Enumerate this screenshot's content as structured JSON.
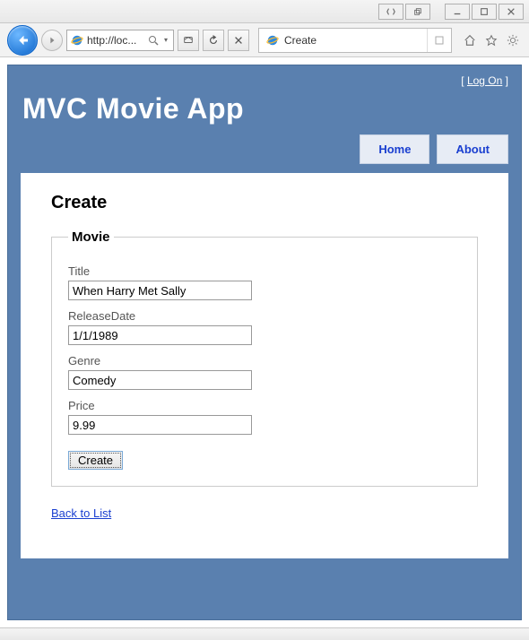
{
  "browser": {
    "url_display": "http://loc...",
    "tab_title": "Create"
  },
  "header": {
    "app_title": "MVC Movie App",
    "logon_left_bracket": "[ ",
    "logon_label": "Log On",
    "logon_right_bracket": " ]"
  },
  "nav": {
    "home": "Home",
    "about": "About"
  },
  "page": {
    "heading": "Create",
    "legend": "Movie",
    "fields": {
      "title_label": "Title",
      "title_value": "When Harry Met Sally",
      "releasedate_label": "ReleaseDate",
      "releasedate_value": "1/1/1989",
      "genre_label": "Genre",
      "genre_value": "Comedy",
      "price_label": "Price",
      "price_value": "9.99"
    },
    "submit_label": "Create",
    "back_link": "Back to List"
  }
}
